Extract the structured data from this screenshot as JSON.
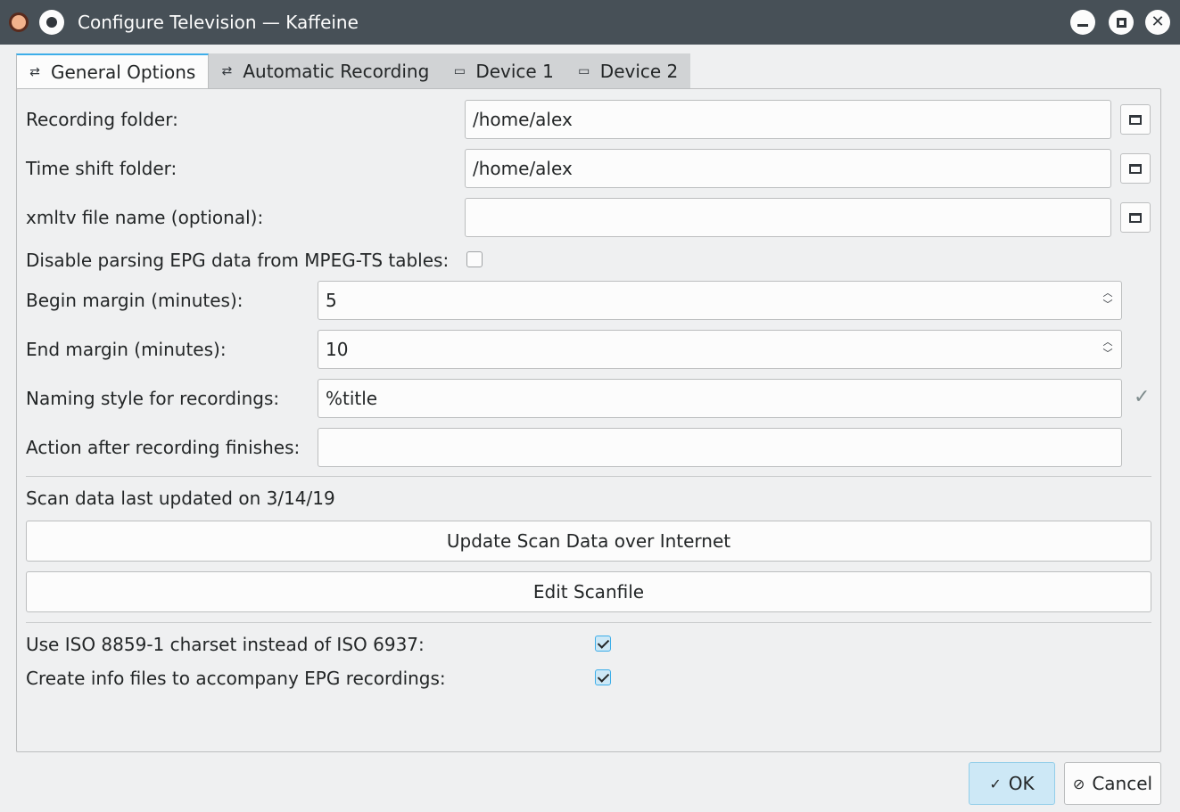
{
  "window": {
    "title": "Configure Television — Kaffeine",
    "min_icon": "minimize-icon",
    "max_icon": "maximize-icon",
    "close_icon": "close-icon"
  },
  "tabs": [
    {
      "label": "General Options",
      "icon": "settings-sliders-icon",
      "active": true
    },
    {
      "label": "Automatic Recording",
      "icon": "settings-sliders-icon",
      "active": false
    },
    {
      "label": "Device 1",
      "icon": "monitor-icon",
      "active": false
    },
    {
      "label": "Device 2",
      "icon": "monitor-icon",
      "active": false
    }
  ],
  "form": {
    "recording_folder": {
      "label": "Recording folder:",
      "value": "/home/alex"
    },
    "time_shift_folder": {
      "label": "Time shift folder:",
      "value": "/home/alex"
    },
    "xmltv_file": {
      "label": "xmltv file name (optional):",
      "value": ""
    },
    "disable_epg": {
      "label": "Disable parsing EPG data from MPEG-TS tables:",
      "checked": false
    },
    "begin_margin": {
      "label": "Begin margin (minutes):",
      "value": "5"
    },
    "end_margin": {
      "label": "End margin (minutes):",
      "value": "10"
    },
    "naming_style": {
      "label": "Naming style for recordings:",
      "value": "%title"
    },
    "action_after": {
      "label": "Action after recording finishes:",
      "value": ""
    }
  },
  "scan": {
    "status": "Scan data last updated on 3/14/19",
    "update_button": "Update Scan Data over Internet",
    "edit_button": "Edit Scanfile"
  },
  "options": {
    "iso_charset": {
      "label": "Use ISO 8859-1 charset instead of ISO 6937:",
      "checked": true
    },
    "info_files": {
      "label": "Create info files to accompany EPG recordings:",
      "checked": true
    }
  },
  "buttons": {
    "ok": "OK",
    "cancel": "Cancel"
  },
  "colors": {
    "accent": "#3daee9",
    "titlebar": "#475057",
    "background": "#eff0f1"
  }
}
